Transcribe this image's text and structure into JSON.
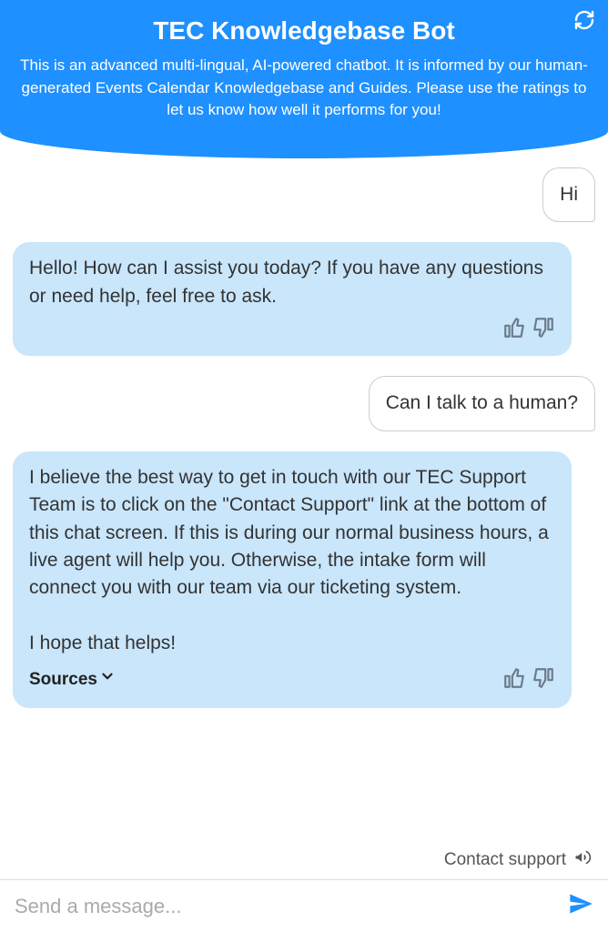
{
  "header": {
    "title": "TEC Knowledgebase Bot",
    "subtitle": "This is an advanced multi-lingual, AI-powered chatbot. It is informed by our human-generated Events Calendar Knowledgebase and Guides. Please use the ratings to let us know how well it performs for you!",
    "refresh_icon": "refresh-icon"
  },
  "messages": [
    {
      "role": "user",
      "text": "Hi"
    },
    {
      "role": "bot",
      "text": "Hello! How can I assist you today? If you have any questions or need help, feel free to ask.",
      "has_sources": false
    },
    {
      "role": "user",
      "text": "Can I talk to a human?"
    },
    {
      "role": "bot",
      "text": "I believe the best way to get in touch with our TEC Support Team is to click on the \"Contact Support\" link at the bottom of this chat screen. If this is during our normal business hours, a live agent will help you. Otherwise, the intake form will connect you with our team via our ticketing system.\n\nI hope that helps!",
      "has_sources": true
    }
  ],
  "sources_label": "Sources",
  "footer": {
    "contact_label": "Contact support"
  },
  "input": {
    "placeholder": "Send a message...",
    "value": ""
  },
  "icons": {
    "thumbs_up": "thumbs-up-icon",
    "thumbs_down": "thumbs-down-icon",
    "megaphone": "megaphone-icon",
    "send": "send-icon",
    "chevron_down": "chevron-down-icon"
  }
}
